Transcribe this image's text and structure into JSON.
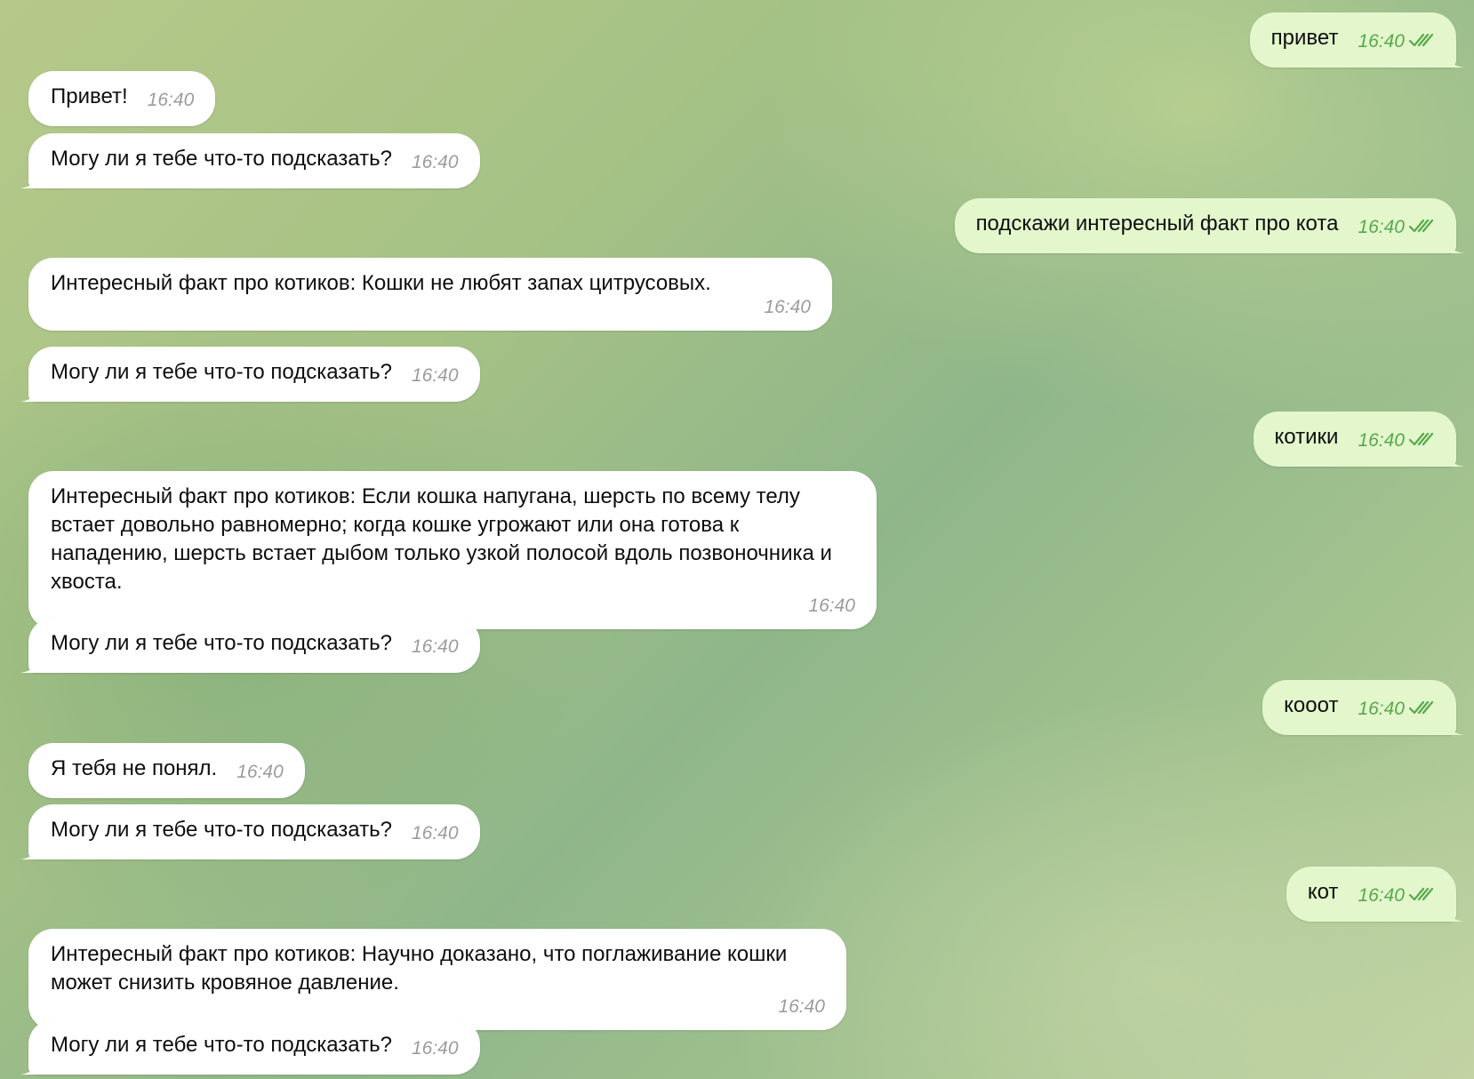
{
  "chat": {
    "messages": [
      {
        "direction": "out",
        "text": "привет",
        "time": "16:40",
        "status": "read"
      },
      {
        "direction": "in",
        "text": "Привет!",
        "time": "16:40"
      },
      {
        "direction": "in",
        "text": "Могу ли я тебе что-то подсказать?",
        "time": "16:40"
      },
      {
        "direction": "out",
        "text": "подскажи интересный факт про кота",
        "time": "16:40",
        "status": "read"
      },
      {
        "direction": "in",
        "text": "Интересный факт про котиков: Кошки не любят запах цитрусовых.",
        "time": "16:40"
      },
      {
        "direction": "in",
        "text": "Могу ли я тебе что-то подсказать?",
        "time": "16:40"
      },
      {
        "direction": "out",
        "text": "котики",
        "time": "16:40",
        "status": "read"
      },
      {
        "direction": "in",
        "text": "Интересный факт про котиков: Если кошка напугана, шерсть по всему телу встает довольно равномерно; когда кошке угрожают или она готова к нападению, шерсть встает дыбом только узкой полосой вдоль позвоночника и хвоста.",
        "time": "16:40"
      },
      {
        "direction": "in",
        "text": "Могу ли я тебе что-то подсказать?",
        "time": "16:40"
      },
      {
        "direction": "out",
        "text": "кооот",
        "time": "16:40",
        "status": "read"
      },
      {
        "direction": "in",
        "text": "Я тебя не понял.",
        "time": "16:40"
      },
      {
        "direction": "in",
        "text": "Могу ли я тебе что-то подсказать?",
        "time": "16:40"
      },
      {
        "direction": "out",
        "text": "кот",
        "time": "16:40",
        "status": "read"
      },
      {
        "direction": "in",
        "text": "Интересный факт про котиков: Научно доказано, что поглаживание кошки может снизить кровяное давление.",
        "time": "16:40"
      },
      {
        "direction": "in",
        "text": "Могу ли я тебе что-то подсказать?",
        "time": "16:40"
      }
    ]
  },
  "icons": {
    "read_receipt": "double-check-icon"
  },
  "colors": {
    "incoming_bubble": "#ffffff",
    "outgoing_bubble": "#e3f6cc",
    "outgoing_meta": "#57a94b",
    "incoming_meta": "#9c9c9c",
    "wallpaper": "#a6c285"
  }
}
